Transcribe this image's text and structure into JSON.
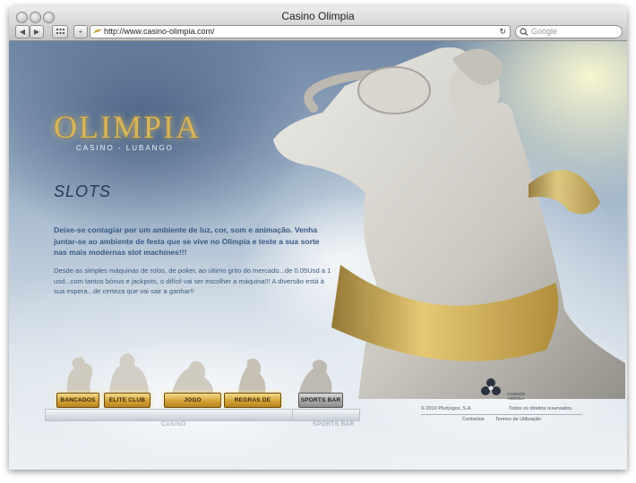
{
  "window": {
    "title": "Casino Olimpia",
    "url": "http://www.casino-olimpia.com/",
    "search_placeholder": "Google",
    "nav_back": "◀",
    "nav_forward": "▶",
    "add_bookmark": "+",
    "reload": "↻"
  },
  "brand": {
    "logo_text": "OLIMPIA",
    "logo_sub": "CASINO - LUBANGO"
  },
  "page": {
    "section_title": "SLOTS",
    "intro": "Deixe-se contagiar por um ambiente de luz, cor, som e animação. Venha juntar-se ao ambiente de festa que se vive no Olimpia e teste a sua sorte nas mais modernas slot machines!!!",
    "body": "Desde as simples máquinas de rolos, de poker, ao último grito do mercado...de 0.05Usd a 1 usd...com tantos bónus e jackpots, o difícil vai ser escolher a máquina!!! A diversão está à sua espera...de certeza que vai sair a ganhar!!"
  },
  "nav": {
    "items": [
      {
        "label": "BANCADOS"
      },
      {
        "label": "ELITE CLUB"
      },
      {
        "label": "JOGO RESPONSÁVEL"
      },
      {
        "label": "REGRAS DE JOGO"
      },
      {
        "label": "SPORTS BAR"
      }
    ],
    "casino_shelf_label": "CASINO",
    "sports_shelf_label": "SPORTS BAR"
  },
  "footer": {
    "copyright": "© 2010 Plurijogos, S.A.",
    "partner_name": "CASINOS ANGOLA",
    "rights": "Todos os direitos reservados.",
    "links": [
      "Contactos",
      "Termos de Utilização"
    ]
  },
  "colors": {
    "gold": "#d7b55a",
    "title_blue": "#243a57",
    "text_blue": "#3a5a84"
  }
}
